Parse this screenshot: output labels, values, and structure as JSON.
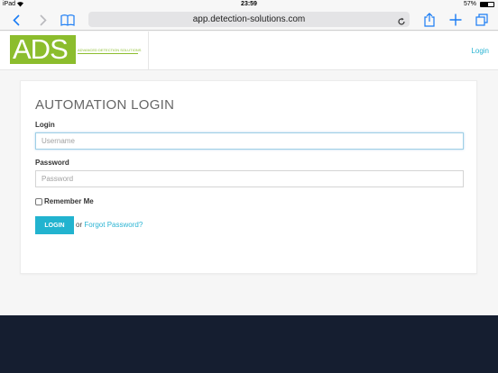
{
  "status_bar": {
    "device": "iPad",
    "time": "23:59",
    "battery": "57%",
    "battery_level": 0.57
  },
  "browser": {
    "url": "app.detection-solutions.com",
    "icons": {
      "back": "chevron-left-icon",
      "forward": "chevron-right-icon",
      "bookmarks": "book-icon",
      "reload": "reload-icon",
      "share": "share-icon",
      "new_tab": "plus-icon",
      "tabs": "tabs-icon"
    }
  },
  "header": {
    "logo_text": "ADS",
    "logo_tagline": "Advanced Detection Solutions",
    "login_link": "Login",
    "brand_color": "#8cbd2d",
    "accent_color": "#2bb4d3"
  },
  "login_form": {
    "title": "AUTOMATION LOGIN",
    "login_label": "Login",
    "username_placeholder": "Username",
    "password_label": "Password",
    "password_placeholder": "Password",
    "remember_label": "Remember Me",
    "remember_checked": false,
    "submit_label": "LOGIN",
    "or_text": "or",
    "forgot_link": "Forgot Password?"
  },
  "footer": {
    "background_color": "#151e30"
  }
}
